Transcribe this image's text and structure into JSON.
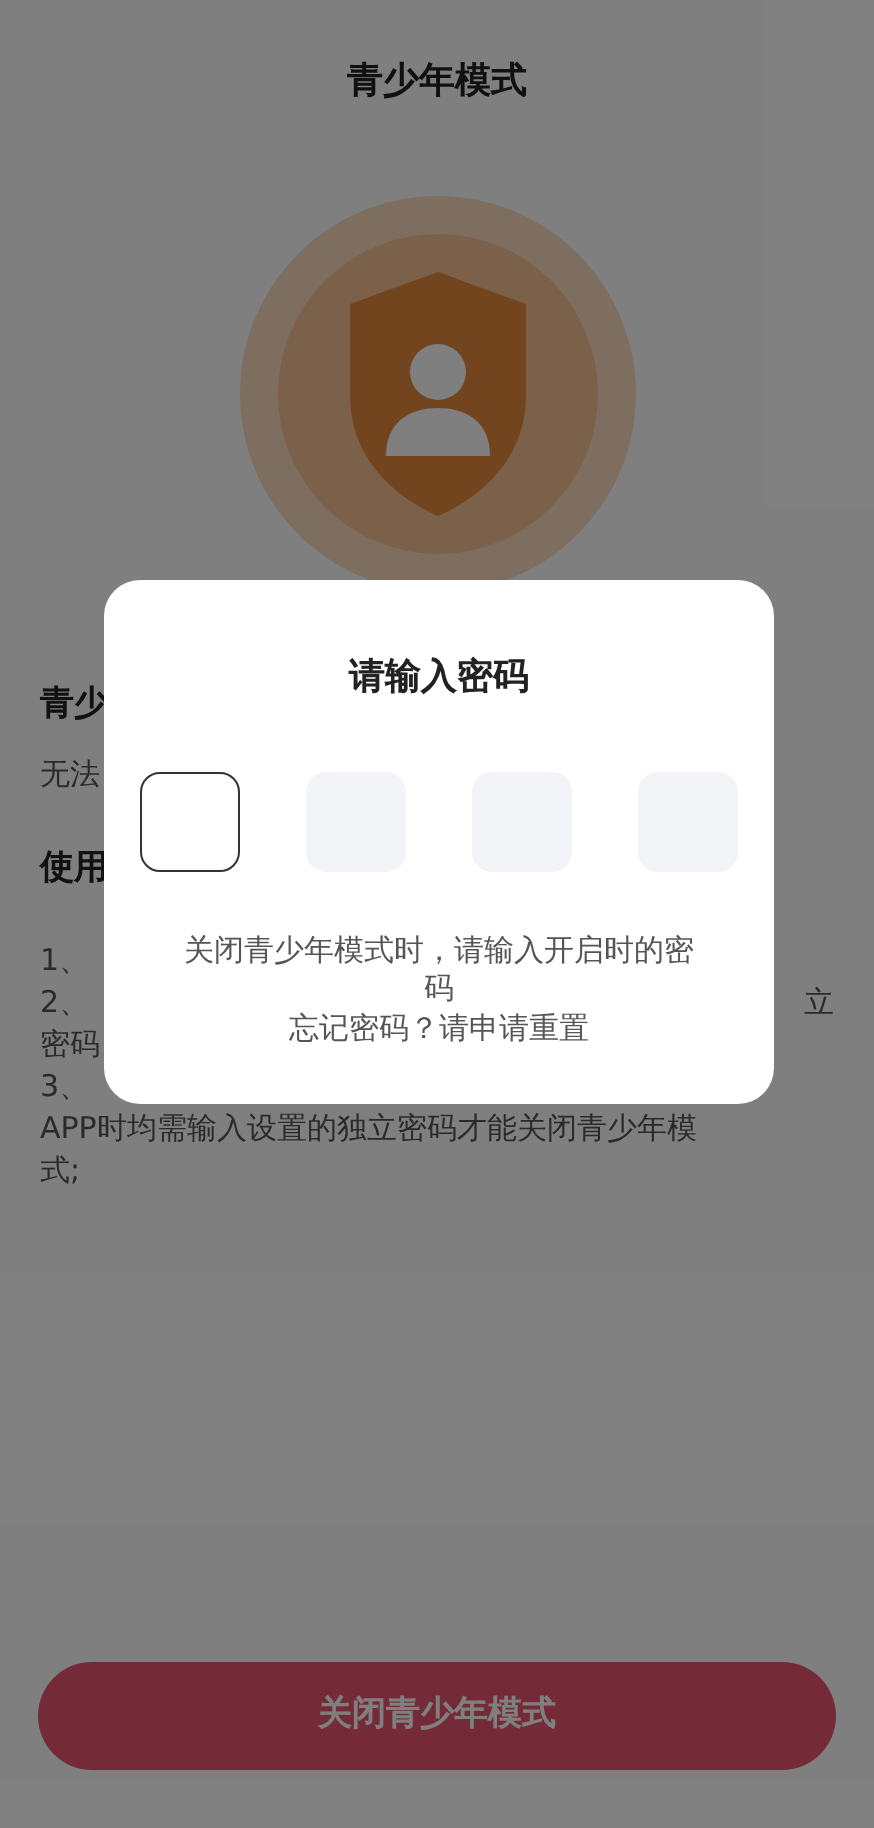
{
  "page": {
    "title": "青少年模式"
  },
  "background_lines": [
    {
      "kind": "heading",
      "left": "青少"
    },
    {
      "kind": "body",
      "left": "无法"
    },
    {
      "kind": "heading",
      "left": "使用"
    },
    {
      "kind": "list",
      "left": "1、"
    },
    {
      "kind": "list",
      "left": "2、",
      "right": "立"
    },
    {
      "kind": "list",
      "left": "密码"
    },
    {
      "kind": "list",
      "left": "3、"
    },
    {
      "kind": "list",
      "left": "APP时均需输入设置的独立密码才能关闭青少年模"
    },
    {
      "kind": "list",
      "left": "式;"
    }
  ],
  "bottom_button": {
    "label": "关闭青少年模式"
  },
  "dialog": {
    "title": "请输入密码",
    "code_boxes": [
      {
        "selected": true
      },
      {
        "selected": false
      },
      {
        "selected": false
      },
      {
        "selected": false
      }
    ],
    "hint": "关闭青少年模式时，请输入开启时的密码",
    "reset_text": "忘记密码？请申请重置"
  }
}
